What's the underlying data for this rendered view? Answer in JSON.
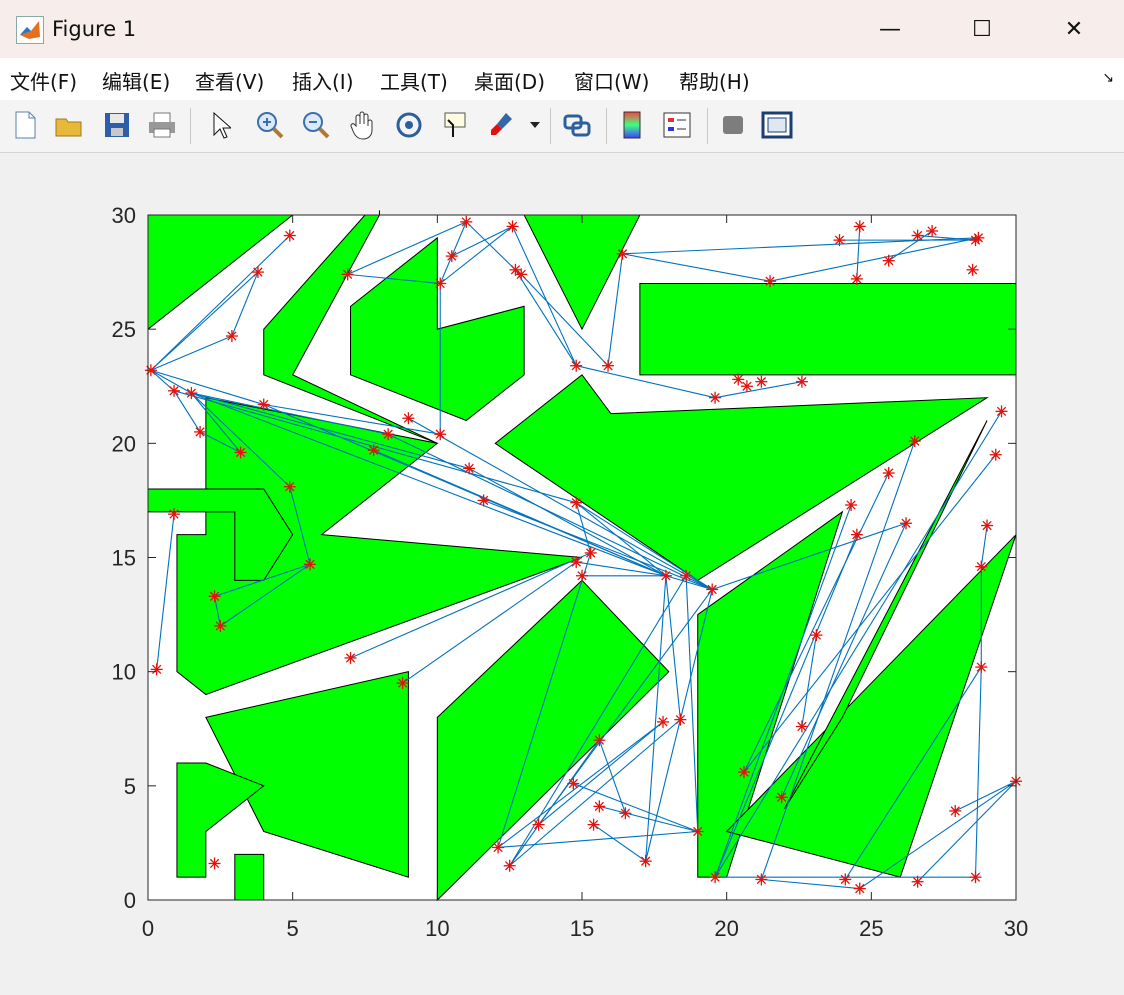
{
  "window": {
    "title": "Figure 1",
    "minimize": "—",
    "maximize": "☐",
    "close": "✕"
  },
  "menu": [
    "文件(F)",
    "编辑(E)",
    "查看(V)",
    "插入(I)",
    "工具(T)",
    "桌面(D)",
    "窗口(W)",
    "帮助(H)"
  ],
  "toolbar_icons": [
    "new-figure-icon",
    "open-file-icon",
    "save-icon",
    "print-icon",
    "select-pointer-icon",
    "zoom-in-icon",
    "zoom-out-icon",
    "pan-hand-icon",
    "rotate-3d-icon",
    "data-cursor-icon",
    "brush-icon",
    "brush-dropdown-icon",
    "link-plot-icon",
    "colorbar-icon",
    "legend-icon",
    "hide-plot-tools-icon",
    "show-plot-tools-icon"
  ],
  "colors": {
    "obstacle": "#00ff00",
    "edge": "#0072bd",
    "node": "#e3120b",
    "axes_bg": "#ffffff"
  },
  "chart_data": {
    "type": "scatter",
    "title": "",
    "xlabel": "",
    "ylabel": "",
    "xlim": [
      0,
      30
    ],
    "ylim": [
      0,
      30
    ],
    "xticks": [
      "0",
      "5",
      "10",
      "15",
      "20",
      "25",
      "30"
    ],
    "yticks": [
      "0",
      "5",
      "10",
      "15",
      "20",
      "25",
      "30"
    ],
    "obstacles": [
      [
        [
          0,
          30
        ],
        [
          5,
          30
        ],
        [
          0,
          25
        ]
      ],
      [
        [
          4,
          23
        ],
        [
          8,
          30
        ],
        [
          8,
          30.2
        ],
        [
          8,
          30
        ],
        [
          8,
          30
        ],
        [
          4,
          23
        ]
      ],
      [
        [
          4,
          25
        ],
        [
          7.5,
          30
        ],
        [
          8,
          30
        ],
        [
          5,
          23
        ],
        [
          10,
          20
        ],
        [
          4,
          23
        ]
      ],
      [
        [
          7,
          26
        ],
        [
          10,
          29
        ],
        [
          10,
          25
        ],
        [
          13,
          26
        ],
        [
          13,
          23
        ],
        [
          11,
          21
        ],
        [
          7,
          23
        ]
      ],
      [
        [
          13,
          30
        ],
        [
          17,
          30
        ],
        [
          15,
          25
        ]
      ],
      [
        [
          17,
          27
        ],
        [
          30,
          27
        ],
        [
          30,
          23
        ],
        [
          17,
          23
        ]
      ],
      [
        [
          2,
          22
        ],
        [
          10,
          20
        ],
        [
          6,
          16
        ],
        [
          15,
          15
        ],
        [
          2,
          9
        ],
        [
          1,
          10
        ],
        [
          1,
          16
        ],
        [
          2,
          16
        ]
      ],
      [
        [
          0,
          18
        ],
        [
          4,
          18
        ],
        [
          5,
          16
        ],
        [
          4,
          14
        ],
        [
          3,
          14
        ],
        [
          3,
          17
        ],
        [
          0,
          17
        ]
      ],
      [
        [
          12,
          20
        ],
        [
          15,
          23
        ],
        [
          16,
          21.3
        ],
        [
          29,
          22
        ],
        [
          19,
          14
        ]
      ],
      [
        [
          2,
          8
        ],
        [
          9,
          10
        ],
        [
          9,
          1
        ],
        [
          4,
          3
        ]
      ],
      [
        [
          1,
          6
        ],
        [
          2,
          6
        ],
        [
          4,
          5
        ],
        [
          2,
          3
        ],
        [
          2,
          1
        ],
        [
          1,
          1
        ]
      ],
      [
        [
          3,
          2
        ],
        [
          4,
          2
        ],
        [
          4,
          0
        ],
        [
          3,
          0
        ]
      ],
      [
        [
          10,
          8
        ],
        [
          15,
          14
        ],
        [
          18,
          10
        ],
        [
          10,
          0
        ]
      ],
      [
        [
          19,
          12.5
        ],
        [
          24,
          17
        ],
        [
          20,
          1
        ],
        [
          19,
          1
        ]
      ],
      [
        [
          20,
          3
        ],
        [
          30,
          16
        ],
        [
          26,
          1
        ]
      ],
      [
        [
          24,
          8
        ],
        [
          29,
          21
        ],
        [
          22,
          4
        ]
      ]
    ],
    "nodes": [
      [
        0.1,
        23.2
      ],
      [
        0.9,
        22.3
      ],
      [
        1.5,
        22.2
      ],
      [
        1.8,
        20.5
      ],
      [
        3.2,
        19.6
      ],
      [
        2.9,
        24.7
      ],
      [
        3.8,
        27.5
      ],
      [
        4.9,
        29.1
      ],
      [
        4.0,
        21.7
      ],
      [
        4.9,
        18.1
      ],
      [
        5.6,
        14.7
      ],
      [
        0.9,
        16.9
      ],
      [
        0.3,
        10.1
      ],
      [
        2.3,
        13.3
      ],
      [
        2.5,
        12.0
      ],
      [
        2.3,
        1.6
      ],
      [
        6.9,
        27.4
      ],
      [
        7.8,
        19.7
      ],
      [
        8.3,
        20.4
      ],
      [
        9.0,
        21.1
      ],
      [
        10.1,
        20.4
      ],
      [
        10.1,
        27.0
      ],
      [
        10.5,
        28.2
      ],
      [
        11.0,
        29.7
      ],
      [
        11.1,
        18.9
      ],
      [
        11.6,
        17.5
      ],
      [
        12.6,
        29.5
      ],
      [
        12.7,
        27.6
      ],
      [
        12.9,
        27.4
      ],
      [
        14.8,
        23.4
      ],
      [
        14.8,
        17.4
      ],
      [
        14.8,
        14.8
      ],
      [
        15.0,
        14.2
      ],
      [
        15.3,
        15.2
      ],
      [
        15.9,
        23.4
      ],
      [
        16.4,
        28.3
      ],
      [
        17.9,
        14.2
      ],
      [
        18.6,
        14.2
      ],
      [
        19.5,
        13.6
      ],
      [
        19.6,
        22.0
      ],
      [
        20.4,
        22.8
      ],
      [
        20.7,
        22.5
      ],
      [
        21.2,
        22.7
      ],
      [
        22.6,
        22.7
      ],
      [
        21.5,
        27.1
      ],
      [
        23.9,
        28.9
      ],
      [
        24.5,
        27.2
      ],
      [
        24.6,
        29.5
      ],
      [
        25.6,
        28.0
      ],
      [
        26.6,
        29.1
      ],
      [
        27.1,
        29.3
      ],
      [
        28.5,
        27.6
      ],
      [
        28.6,
        28.9
      ],
      [
        28.7,
        29.0
      ],
      [
        7.0,
        10.6
      ],
      [
        8.8,
        9.5
      ],
      [
        12.1,
        2.3
      ],
      [
        12.5,
        1.5
      ],
      [
        13.5,
        3.3
      ],
      [
        14.7,
        5.1
      ],
      [
        15.4,
        3.3
      ],
      [
        15.6,
        7.0
      ],
      [
        15.6,
        4.1
      ],
      [
        16.5,
        3.8
      ],
      [
        17.2,
        1.7
      ],
      [
        17.8,
        7.8
      ],
      [
        18.4,
        7.9
      ],
      [
        19.0,
        3.0
      ],
      [
        19.6,
        1.0
      ],
      [
        20.6,
        5.6
      ],
      [
        21.2,
        0.9
      ],
      [
        21.9,
        4.5
      ],
      [
        22.6,
        7.6
      ],
      [
        23.1,
        11.6
      ],
      [
        24.1,
        0.9
      ],
      [
        24.6,
        0.5
      ],
      [
        24.3,
        17.3
      ],
      [
        24.5,
        16.0
      ],
      [
        25.6,
        18.7
      ],
      [
        26.2,
        16.5
      ],
      [
        26.5,
        20.1
      ],
      [
        26.6,
        0.8
      ],
      [
        27.9,
        3.9
      ],
      [
        28.6,
        1.0
      ],
      [
        28.8,
        10.2
      ],
      [
        28.8,
        14.6
      ],
      [
        29.0,
        16.4
      ],
      [
        29.3,
        19.5
      ],
      [
        29.5,
        21.4
      ],
      [
        30.0,
        5.2
      ]
    ],
    "edges": [
      [
        0,
        1
      ],
      [
        0,
        2
      ],
      [
        0,
        5
      ],
      [
        0,
        6
      ],
      [
        0,
        7
      ],
      [
        0,
        8
      ],
      [
        1,
        3
      ],
      [
        2,
        4
      ],
      [
        2,
        9
      ],
      [
        3,
        4
      ],
      [
        6,
        5
      ],
      [
        2,
        18
      ],
      [
        2,
        24
      ],
      [
        2,
        36
      ],
      [
        1,
        30
      ],
      [
        8,
        20
      ],
      [
        8,
        36
      ],
      [
        9,
        10
      ],
      [
        10,
        13
      ],
      [
        11,
        12
      ],
      [
        13,
        14
      ],
      [
        16,
        23
      ],
      [
        20,
        21
      ],
      [
        21,
        22
      ],
      [
        22,
        23
      ],
      [
        22,
        26
      ],
      [
        23,
        27
      ],
      [
        26,
        29
      ],
      [
        27,
        29
      ],
      [
        28,
        34
      ],
      [
        29,
        39
      ],
      [
        39,
        43
      ],
      [
        35,
        44
      ],
      [
        35,
        53
      ],
      [
        44,
        53
      ],
      [
        45,
        52
      ],
      [
        46,
        47
      ],
      [
        48,
        50
      ],
      [
        49,
        52
      ],
      [
        21,
        26
      ],
      [
        17,
        36
      ],
      [
        18,
        38
      ],
      [
        19,
        38
      ],
      [
        24,
        36
      ],
      [
        25,
        38
      ],
      [
        30,
        38
      ],
      [
        30,
        36
      ],
      [
        33,
        54
      ],
      [
        31,
        55
      ],
      [
        32,
        36
      ],
      [
        36,
        64
      ],
      [
        37,
        57
      ],
      [
        38,
        58
      ],
      [
        33,
        56
      ],
      [
        56,
        67
      ],
      [
        57,
        66
      ],
      [
        58,
        65
      ],
      [
        59,
        67
      ],
      [
        60,
        64
      ],
      [
        61,
        63
      ],
      [
        62,
        67
      ],
      [
        56,
        65
      ],
      [
        57,
        61
      ],
      [
        68,
        77
      ],
      [
        68,
        76
      ],
      [
        69,
        78
      ],
      [
        70,
        80
      ],
      [
        71,
        79
      ],
      [
        72,
        73
      ],
      [
        68,
        88
      ],
      [
        69,
        87
      ],
      [
        74,
        84
      ],
      [
        75,
        89
      ],
      [
        81,
        89
      ],
      [
        82,
        89
      ],
      [
        83,
        84
      ],
      [
        84,
        85
      ],
      [
        85,
        86
      ],
      [
        70,
        75
      ],
      [
        68,
        83
      ],
      [
        36,
        38
      ],
      [
        38,
        79
      ],
      [
        31,
        36
      ],
      [
        30,
        33
      ],
      [
        35,
        34
      ],
      [
        16,
        21
      ],
      [
        10,
        14
      ],
      [
        36,
        66
      ],
      [
        37,
        67
      ],
      [
        38,
        64
      ]
    ]
  }
}
